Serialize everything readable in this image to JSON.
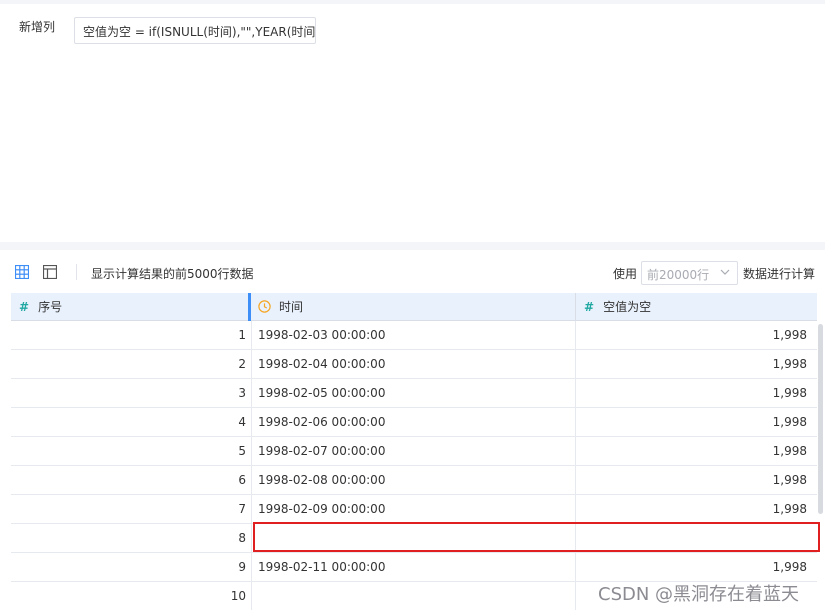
{
  "formula": {
    "label": "新增列",
    "expression": "空值为空 = if(ISNULL(时间),\"\",YEAR(时间))"
  },
  "toolbar": {
    "info": "显示计算结果的前5000行数据",
    "use_label": "使用",
    "row_select": "前20000行",
    "calc_label": "数据进行计算",
    "icons": [
      "table-grid-icon",
      "layout-icon",
      "chevron-down-icon"
    ]
  },
  "table": {
    "columns": [
      {
        "name": "序号",
        "type_icon": "#"
      },
      {
        "name": "时间",
        "type_icon": "clock-icon"
      },
      {
        "name": "空值为空",
        "type_icon": "#"
      }
    ],
    "rows": [
      {
        "idx": "1",
        "time": "1998-02-03 00:00:00",
        "value": "1,998"
      },
      {
        "idx": "2",
        "time": "1998-02-04 00:00:00",
        "value": "1,998"
      },
      {
        "idx": "3",
        "time": "1998-02-05 00:00:00",
        "value": "1,998"
      },
      {
        "idx": "4",
        "time": "1998-02-06 00:00:00",
        "value": "1,998"
      },
      {
        "idx": "5",
        "time": "1998-02-07 00:00:00",
        "value": "1,998"
      },
      {
        "idx": "6",
        "time": "1998-02-08 00:00:00",
        "value": "1,998"
      },
      {
        "idx": "7",
        "time": "1998-02-09 00:00:00",
        "value": "1,998"
      },
      {
        "idx": "8",
        "time": "",
        "value": ""
      },
      {
        "idx": "9",
        "time": "1998-02-11 00:00:00",
        "value": "1,998"
      },
      {
        "idx": "10",
        "time": "",
        "value": ""
      }
    ]
  },
  "watermark": "CSDN @黑洞存在着蓝天",
  "colors": {
    "accent": "#3e8ef7",
    "header_bg": "#e9f1fc",
    "number_icon": "#20a8a2",
    "clock_icon": "#f5a623",
    "highlight": "#e02020"
  }
}
